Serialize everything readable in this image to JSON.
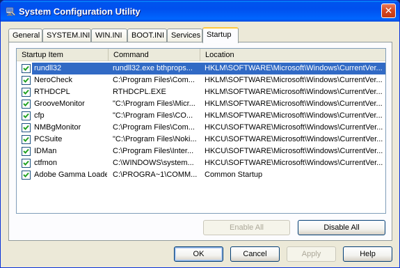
{
  "window": {
    "title": "System Configuration Utility",
    "close_symbol": "✕"
  },
  "tabs": [
    {
      "label": "General"
    },
    {
      "label": "SYSTEM.INI"
    },
    {
      "label": "WIN.INI"
    },
    {
      "label": "BOOT.INI"
    },
    {
      "label": "Services"
    },
    {
      "label": "Startup"
    }
  ],
  "active_tab": "Startup",
  "startup_list": {
    "columns": [
      "Startup Item",
      "Command",
      "Location"
    ],
    "rows": [
      {
        "checked": true,
        "item": "rundll32",
        "command": "rundll32.exe bthprops...",
        "location": "HKLM\\SOFTWARE\\Microsoft\\Windows\\CurrentVer..."
      },
      {
        "checked": true,
        "item": "NeroCheck",
        "command": "C:\\Program Files\\Com...",
        "location": "HKLM\\SOFTWARE\\Microsoft\\Windows\\CurrentVer..."
      },
      {
        "checked": true,
        "item": "RTHDCPL",
        "command": "RTHDCPL.EXE",
        "location": "HKLM\\SOFTWARE\\Microsoft\\Windows\\CurrentVer..."
      },
      {
        "checked": true,
        "item": "GrooveMonitor",
        "command": "\"C:\\Program Files\\Micr...",
        "location": "HKLM\\SOFTWARE\\Microsoft\\Windows\\CurrentVer..."
      },
      {
        "checked": true,
        "item": "cfp",
        "command": "\"C:\\Program Files\\CO...",
        "location": "HKLM\\SOFTWARE\\Microsoft\\Windows\\CurrentVer..."
      },
      {
        "checked": true,
        "item": "NMBgMonitor",
        "command": "C:\\Program Files\\Com...",
        "location": "HKCU\\SOFTWARE\\Microsoft\\Windows\\CurrentVer..."
      },
      {
        "checked": true,
        "item": "PCSuite",
        "command": "\"C:\\Program Files\\Noki...",
        "location": "HKCU\\SOFTWARE\\Microsoft\\Windows\\CurrentVer..."
      },
      {
        "checked": true,
        "item": "IDMan",
        "command": "C:\\Program Files\\Inter...",
        "location": "HKCU\\SOFTWARE\\Microsoft\\Windows\\CurrentVer..."
      },
      {
        "checked": true,
        "item": "ctfmon",
        "command": "C:\\WINDOWS\\system...",
        "location": "HKCU\\SOFTWARE\\Microsoft\\Windows\\CurrentVer..."
      },
      {
        "checked": true,
        "item": "Adobe Gamma Loader",
        "command": "C:\\PROGRA~1\\COMM...",
        "location": "Common Startup"
      }
    ],
    "selected_row": 0
  },
  "panel_buttons": {
    "enable_all": "Enable All",
    "disable_all": "Disable All"
  },
  "dialog_buttons": {
    "ok": "OK",
    "cancel": "Cancel",
    "apply": "Apply",
    "help": "Help"
  },
  "colors": {
    "selection": "#316ac5",
    "titlebar": "#0050ee",
    "active_tab_accent": "#ffc83c"
  }
}
